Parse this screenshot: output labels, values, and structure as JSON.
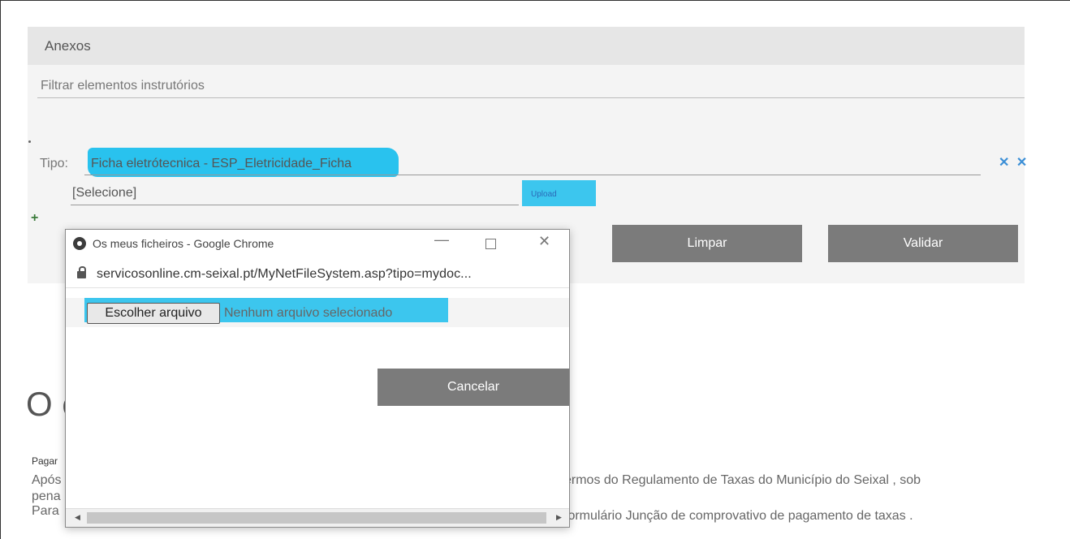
{
  "page": {
    "section_title": "Anexos",
    "filter_text": "Filtrar elementos instrutórios",
    "tipo_label": "Tipo:",
    "tipo_value": "Ficha eletrótecnica - ESP_Eletricidade_Ficha",
    "select_value": "[Selecione]",
    "upload_label": "Upload",
    "remove_icons": "✕ ✕",
    "add_label": "+",
    "clear_label": "Limpar",
    "validate_label": "Validar",
    "heading_fragment": "O c",
    "pagamento_fragment": "Pagar",
    "text_lines": [
      "Após",
      "pena",
      "Para"
    ],
    "text_right_1": "ermos do  Regulamento de Taxas do Município do Seixal , sob",
    "text_right_2": "formulário Junção de comprovativo de pagamento de taxas ."
  },
  "popup": {
    "window_title": "Os meus ficheiros - Google Chrome",
    "url": "servicosonline.cm-seixal.pt/MyNetFileSystem.asp?tipo=mydoc...",
    "choose_file_label": "Escolher arquivo",
    "file_status": "Nenhum arquivo selecionado",
    "cancel_label": "Cancelar",
    "minimize_glyph": "—",
    "close_glyph": "✕",
    "scroll_left_glyph": "◀",
    "scroll_right_glyph": "▶"
  },
  "colors": {
    "highlight": "#29c2ee",
    "button_gray": "#7b7b7b",
    "panel_bg": "#f4f4f4",
    "panel_header_bg": "#e6e6e6"
  }
}
